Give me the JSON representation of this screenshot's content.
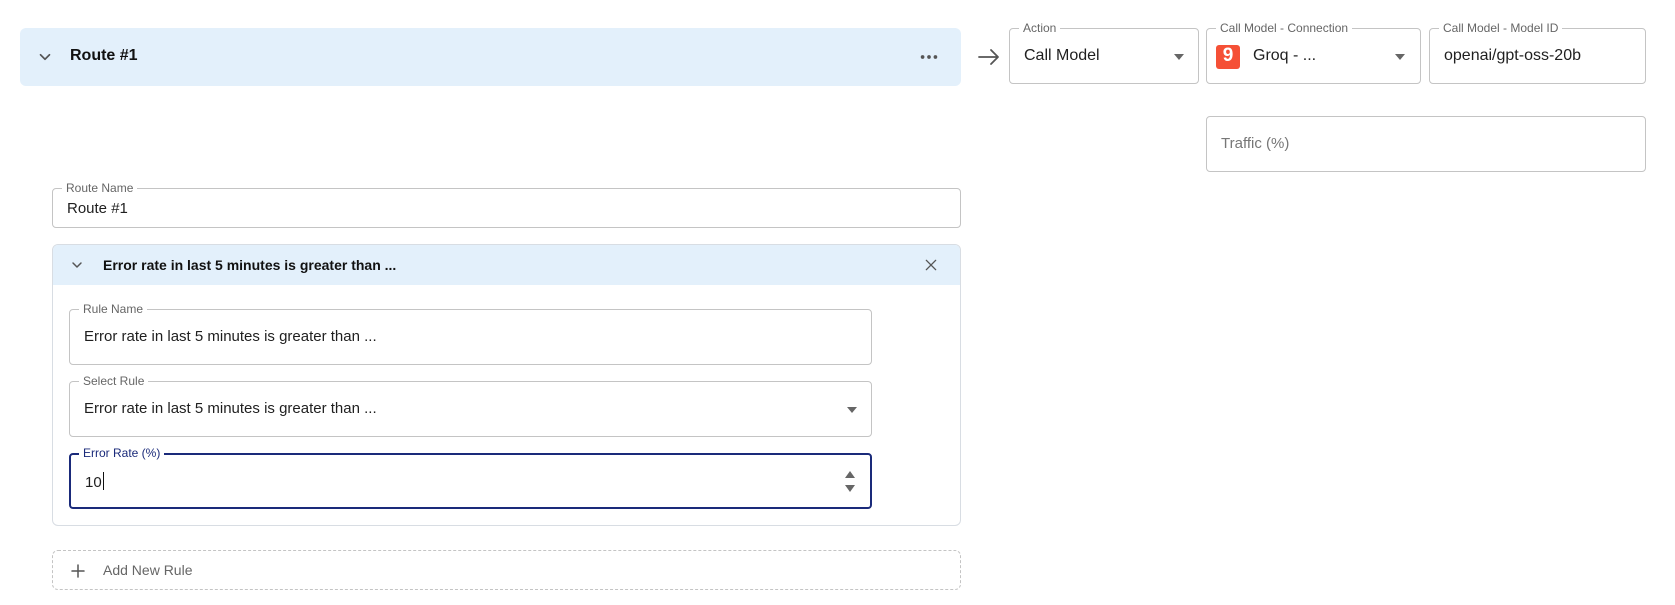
{
  "route": {
    "title": "Route #1"
  },
  "action": {
    "label": "Action",
    "value": "Call Model"
  },
  "connection": {
    "label": "Call Model - Connection",
    "value": "Groq - ...",
    "logo_glyph": "9",
    "logo_color": "#f55036"
  },
  "model_id": {
    "label": "Call Model - Model ID",
    "value": "openai/gpt-oss-20b"
  },
  "traffic": {
    "placeholder": "Traffic (%)"
  },
  "route_name": {
    "label": "Route Name",
    "value": "Route #1"
  },
  "rule": {
    "title": "Error rate in last 5 minutes is greater than ...",
    "rule_name": {
      "label": "Rule Name",
      "value": "Error rate in last 5 minutes is greater than ..."
    },
    "select_rule": {
      "label": "Select Rule",
      "value": "Error rate in last 5 minutes is greater than ..."
    },
    "error_rate": {
      "label": "Error Rate (%)",
      "value": "10"
    }
  },
  "add_rule": {
    "label": "Add New Rule"
  },
  "colors": {
    "header_bg": "#e3f0fb",
    "focus": "#1a2a7a"
  },
  "icons": {
    "collapse": "chevron-down-icon",
    "more": "more-horizontal-icon",
    "arrow": "arrow-right-icon",
    "close": "close-icon",
    "add": "plus-icon",
    "dropdown": "caret-down-icon"
  }
}
